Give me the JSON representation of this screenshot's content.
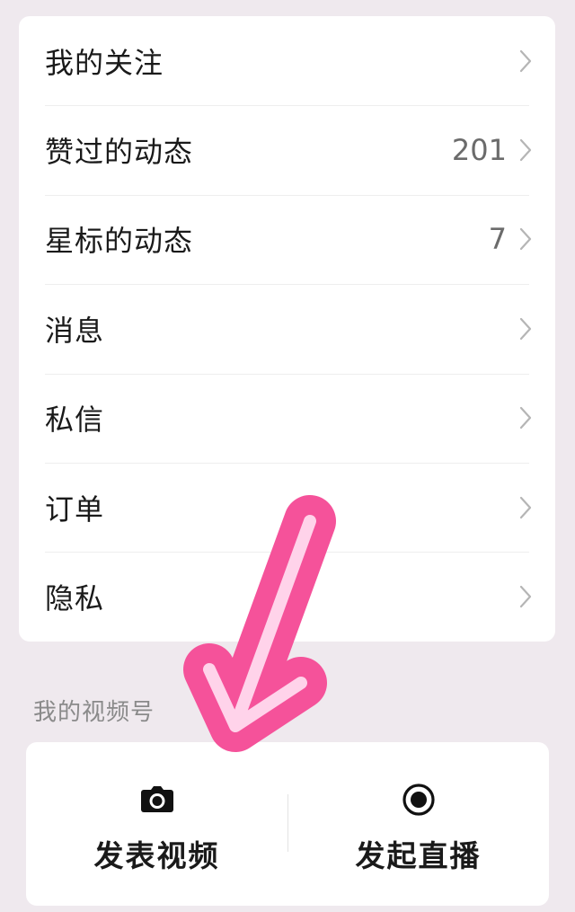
{
  "menu": {
    "items": [
      {
        "label": "我的关注",
        "count": ""
      },
      {
        "label": "赞过的动态",
        "count": "201"
      },
      {
        "label": "星标的动态",
        "count": "7"
      },
      {
        "label": "消息",
        "count": ""
      },
      {
        "label": "私信",
        "count": ""
      },
      {
        "label": "订单",
        "count": ""
      },
      {
        "label": "隐私",
        "count": ""
      }
    ]
  },
  "channels": {
    "section_title": "我的视频号",
    "publish_video_label": "发表视频",
    "go_live_label": "发起直播"
  },
  "icons": {
    "chevron": "chevron-right-icon",
    "publish_video": "camera-icon",
    "go_live": "record-icon",
    "annotation": "arrow-annotation-icon"
  },
  "colors": {
    "annotation_pink": "#f5529a",
    "annotation_light": "#ffd3ea"
  }
}
